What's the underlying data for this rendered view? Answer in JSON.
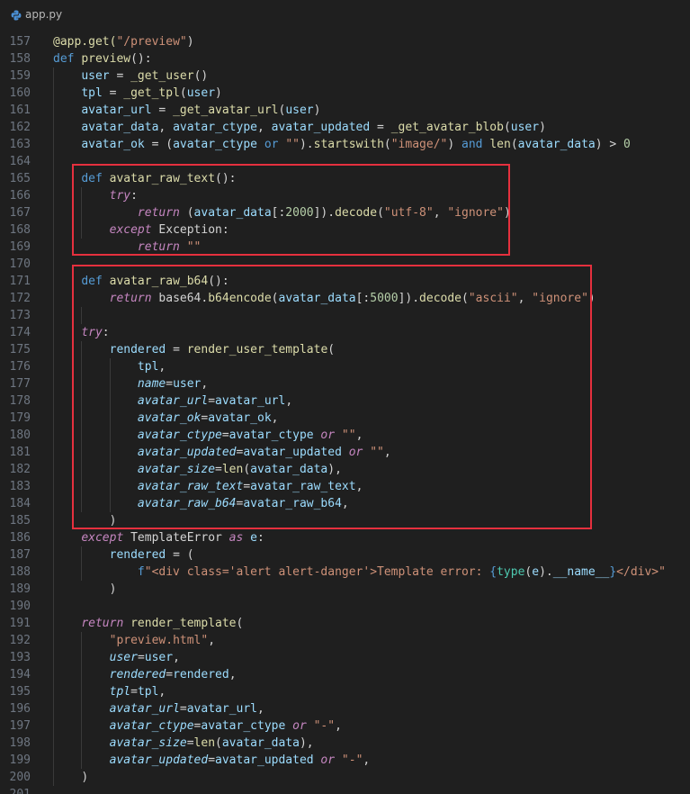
{
  "tab": {
    "filename": "app.py",
    "icon": "python-file-icon"
  },
  "colors": {
    "background": "#1f1f1f",
    "highlight_box": "#e5303e"
  },
  "lines": [
    {
      "n": "157",
      "t": [
        [
          "@app.get(",
          "dec"
        ],
        [
          "\"/preview\"",
          "str"
        ],
        [
          ")",
          "plain"
        ]
      ]
    },
    {
      "n": "158",
      "t": [
        [
          "def ",
          "kw"
        ],
        [
          "preview",
          "fn"
        ],
        [
          "():",
          "plain"
        ]
      ]
    },
    {
      "n": "159",
      "t": [
        [
          "    ",
          "plain"
        ],
        [
          "user",
          "var"
        ],
        [
          " = ",
          "op"
        ],
        [
          "_get_user",
          "fn"
        ],
        [
          "()",
          "plain"
        ]
      ]
    },
    {
      "n": "160",
      "t": [
        [
          "    ",
          "plain"
        ],
        [
          "tpl",
          "var"
        ],
        [
          " = ",
          "op"
        ],
        [
          "_get_tpl",
          "fn"
        ],
        [
          "(",
          "plain"
        ],
        [
          "user",
          "var"
        ],
        [
          ")",
          "plain"
        ]
      ]
    },
    {
      "n": "161",
      "t": [
        [
          "    ",
          "plain"
        ],
        [
          "avatar_url",
          "var"
        ],
        [
          " = ",
          "op"
        ],
        [
          "_get_avatar_url",
          "fn"
        ],
        [
          "(",
          "plain"
        ],
        [
          "user",
          "var"
        ],
        [
          ")",
          "plain"
        ]
      ]
    },
    {
      "n": "162",
      "t": [
        [
          "    ",
          "plain"
        ],
        [
          "avatar_data",
          "var"
        ],
        [
          ", ",
          "plain"
        ],
        [
          "avatar_ctype",
          "var"
        ],
        [
          ", ",
          "plain"
        ],
        [
          "avatar_updated",
          "var"
        ],
        [
          " = ",
          "op"
        ],
        [
          "_get_avatar_blob",
          "fn"
        ],
        [
          "(",
          "plain"
        ],
        [
          "user",
          "var"
        ],
        [
          ")",
          "plain"
        ]
      ]
    },
    {
      "n": "163",
      "t": [
        [
          "    ",
          "plain"
        ],
        [
          "avatar_ok",
          "var"
        ],
        [
          " = (",
          "op"
        ],
        [
          "avatar_ctype",
          "var"
        ],
        [
          " or ",
          "kw"
        ],
        [
          "\"\"",
          "str"
        ],
        [
          ").",
          "plain"
        ],
        [
          "startswith",
          "fn"
        ],
        [
          "(",
          "plain"
        ],
        [
          "\"image/\"",
          "str"
        ],
        [
          ") ",
          "plain"
        ],
        [
          "and ",
          "kw"
        ],
        [
          "len",
          "fn"
        ],
        [
          "(",
          "plain"
        ],
        [
          "avatar_data",
          "var"
        ],
        [
          ") > ",
          "op"
        ],
        [
          "0",
          "num"
        ]
      ]
    },
    {
      "n": "164",
      "t": []
    },
    {
      "n": "165",
      "t": [
        [
          "    ",
          "plain"
        ],
        [
          "def ",
          "kw"
        ],
        [
          "avatar_raw_text",
          "fn"
        ],
        [
          "():",
          "plain"
        ]
      ]
    },
    {
      "n": "166",
      "t": [
        [
          "        ",
          "plain"
        ],
        [
          "try",
          "ctl"
        ],
        [
          ":",
          "plain"
        ]
      ]
    },
    {
      "n": "167",
      "t": [
        [
          "            ",
          "plain"
        ],
        [
          "return ",
          "ctl"
        ],
        [
          "(",
          "plain"
        ],
        [
          "avatar_data",
          "var"
        ],
        [
          "[:",
          "plain"
        ],
        [
          "2000",
          "num"
        ],
        [
          "]).",
          "plain"
        ],
        [
          "decode",
          "fn"
        ],
        [
          "(",
          "plain"
        ],
        [
          "\"utf-8\"",
          "str"
        ],
        [
          ", ",
          "plain"
        ],
        [
          "\"ignore\"",
          "str"
        ],
        [
          ")",
          "plain"
        ]
      ]
    },
    {
      "n": "168",
      "t": [
        [
          "        ",
          "plain"
        ],
        [
          "except ",
          "ctl"
        ],
        [
          "Exception",
          "plain"
        ],
        [
          ":",
          "plain"
        ]
      ]
    },
    {
      "n": "169",
      "t": [
        [
          "            ",
          "plain"
        ],
        [
          "return ",
          "ctl"
        ],
        [
          "\"\"",
          "str"
        ]
      ]
    },
    {
      "n": "170",
      "t": []
    },
    {
      "n": "171",
      "t": [
        [
          "    ",
          "plain"
        ],
        [
          "def ",
          "kw"
        ],
        [
          "avatar_raw_b64",
          "fn"
        ],
        [
          "():",
          "plain"
        ]
      ]
    },
    {
      "n": "172",
      "t": [
        [
          "        ",
          "plain"
        ],
        [
          "return ",
          "ctl"
        ],
        [
          "base64",
          "plain"
        ],
        [
          ".",
          "plain"
        ],
        [
          "b64encode",
          "fn"
        ],
        [
          "(",
          "plain"
        ],
        [
          "avatar_data",
          "var"
        ],
        [
          "[:",
          "plain"
        ],
        [
          "5000",
          "num"
        ],
        [
          "]).",
          "plain"
        ],
        [
          "decode",
          "fn"
        ],
        [
          "(",
          "plain"
        ],
        [
          "\"ascii\"",
          "str"
        ],
        [
          ", ",
          "plain"
        ],
        [
          "\"ignore\"",
          "str"
        ],
        [
          ")",
          "plain"
        ]
      ]
    },
    {
      "n": "173",
      "t": []
    },
    {
      "n": "174",
      "t": [
        [
          "    ",
          "plain"
        ],
        [
          "try",
          "ctl"
        ],
        [
          ":",
          "plain"
        ]
      ]
    },
    {
      "n": "175",
      "t": [
        [
          "        ",
          "plain"
        ],
        [
          "rendered",
          "var"
        ],
        [
          " = ",
          "op"
        ],
        [
          "render_user_template",
          "fn"
        ],
        [
          "(",
          "plain"
        ]
      ]
    },
    {
      "n": "176",
      "t": [
        [
          "            ",
          "plain"
        ],
        [
          "tpl",
          "var"
        ],
        [
          ",",
          "plain"
        ]
      ]
    },
    {
      "n": "177",
      "t": [
        [
          "            ",
          "plain"
        ],
        [
          "name",
          "param"
        ],
        [
          "=",
          "op"
        ],
        [
          "user",
          "var"
        ],
        [
          ",",
          "plain"
        ]
      ]
    },
    {
      "n": "178",
      "t": [
        [
          "            ",
          "plain"
        ],
        [
          "avatar_url",
          "param"
        ],
        [
          "=",
          "op"
        ],
        [
          "avatar_url",
          "var"
        ],
        [
          ",",
          "plain"
        ]
      ]
    },
    {
      "n": "179",
      "t": [
        [
          "            ",
          "plain"
        ],
        [
          "avatar_ok",
          "param"
        ],
        [
          "=",
          "op"
        ],
        [
          "avatar_ok",
          "var"
        ],
        [
          ",",
          "plain"
        ]
      ]
    },
    {
      "n": "180",
      "t": [
        [
          "            ",
          "plain"
        ],
        [
          "avatar_ctype",
          "param"
        ],
        [
          "=",
          "op"
        ],
        [
          "avatar_ctype",
          "var"
        ],
        [
          " or ",
          "ctl"
        ],
        [
          "\"\"",
          "str"
        ],
        [
          ",",
          "plain"
        ]
      ]
    },
    {
      "n": "181",
      "t": [
        [
          "            ",
          "plain"
        ],
        [
          "avatar_updated",
          "param"
        ],
        [
          "=",
          "op"
        ],
        [
          "avatar_updated",
          "var"
        ],
        [
          " or ",
          "ctl"
        ],
        [
          "\"\"",
          "str"
        ],
        [
          ",",
          "plain"
        ]
      ]
    },
    {
      "n": "182",
      "t": [
        [
          "            ",
          "plain"
        ],
        [
          "avatar_size",
          "param"
        ],
        [
          "=",
          "op"
        ],
        [
          "len",
          "fn"
        ],
        [
          "(",
          "plain"
        ],
        [
          "avatar_data",
          "var"
        ],
        [
          "),",
          "plain"
        ]
      ]
    },
    {
      "n": "183",
      "t": [
        [
          "            ",
          "plain"
        ],
        [
          "avatar_raw_text",
          "param"
        ],
        [
          "=",
          "op"
        ],
        [
          "avatar_raw_text",
          "var"
        ],
        [
          ",",
          "plain"
        ]
      ]
    },
    {
      "n": "184",
      "t": [
        [
          "            ",
          "plain"
        ],
        [
          "avatar_raw_b64",
          "param"
        ],
        [
          "=",
          "op"
        ],
        [
          "avatar_raw_b64",
          "var"
        ],
        [
          ",",
          "plain"
        ]
      ]
    },
    {
      "n": "185",
      "t": [
        [
          "        ",
          "plain"
        ],
        [
          ")",
          "plain"
        ]
      ]
    },
    {
      "n": "186",
      "t": [
        [
          "    ",
          "plain"
        ],
        [
          "except ",
          "ctl"
        ],
        [
          "TemplateError",
          "plain"
        ],
        [
          " as ",
          "ctl"
        ],
        [
          "e",
          "var"
        ],
        [
          ":",
          "plain"
        ]
      ]
    },
    {
      "n": "187",
      "t": [
        [
          "        ",
          "plain"
        ],
        [
          "rendered",
          "var"
        ],
        [
          " = (",
          "op"
        ]
      ]
    },
    {
      "n": "188",
      "t": [
        [
          "            ",
          "plain"
        ],
        [
          "f",
          "kw"
        ],
        [
          "\"<div class='alert alert-danger'>Template error: ",
          "str"
        ],
        [
          "{",
          "kw"
        ],
        [
          "type",
          "cls"
        ],
        [
          "(",
          "plain"
        ],
        [
          "e",
          "var"
        ],
        [
          ").",
          "plain"
        ],
        [
          "__name__",
          "var"
        ],
        [
          "}",
          "kw"
        ],
        [
          "</div>\"",
          "str"
        ]
      ]
    },
    {
      "n": "189",
      "t": [
        [
          "        ",
          "plain"
        ],
        [
          ")",
          "plain"
        ]
      ]
    },
    {
      "n": "190",
      "t": []
    },
    {
      "n": "191",
      "t": [
        [
          "    ",
          "plain"
        ],
        [
          "return ",
          "ctl"
        ],
        [
          "render_template",
          "fn"
        ],
        [
          "(",
          "plain"
        ]
      ]
    },
    {
      "n": "192",
      "t": [
        [
          "        ",
          "plain"
        ],
        [
          "\"preview.html\"",
          "str"
        ],
        [
          ",",
          "plain"
        ]
      ]
    },
    {
      "n": "193",
      "t": [
        [
          "        ",
          "plain"
        ],
        [
          "user",
          "param"
        ],
        [
          "=",
          "op"
        ],
        [
          "user",
          "var"
        ],
        [
          ",",
          "plain"
        ]
      ]
    },
    {
      "n": "194",
      "t": [
        [
          "        ",
          "plain"
        ],
        [
          "rendered",
          "param"
        ],
        [
          "=",
          "op"
        ],
        [
          "rendered",
          "var"
        ],
        [
          ",",
          "plain"
        ]
      ]
    },
    {
      "n": "195",
      "t": [
        [
          "        ",
          "plain"
        ],
        [
          "tpl",
          "param"
        ],
        [
          "=",
          "op"
        ],
        [
          "tpl",
          "var"
        ],
        [
          ",",
          "plain"
        ]
      ]
    },
    {
      "n": "196",
      "t": [
        [
          "        ",
          "plain"
        ],
        [
          "avatar_url",
          "param"
        ],
        [
          "=",
          "op"
        ],
        [
          "avatar_url",
          "var"
        ],
        [
          ",",
          "plain"
        ]
      ]
    },
    {
      "n": "197",
      "t": [
        [
          "        ",
          "plain"
        ],
        [
          "avatar_ctype",
          "param"
        ],
        [
          "=",
          "op"
        ],
        [
          "avatar_ctype",
          "var"
        ],
        [
          " or ",
          "ctl"
        ],
        [
          "\"-\"",
          "str"
        ],
        [
          ",",
          "plain"
        ]
      ]
    },
    {
      "n": "198",
      "t": [
        [
          "        ",
          "plain"
        ],
        [
          "avatar_size",
          "param"
        ],
        [
          "=",
          "op"
        ],
        [
          "len",
          "fn"
        ],
        [
          "(",
          "plain"
        ],
        [
          "avatar_data",
          "var"
        ],
        [
          "),",
          "plain"
        ]
      ]
    },
    {
      "n": "199",
      "t": [
        [
          "        ",
          "plain"
        ],
        [
          "avatar_updated",
          "param"
        ],
        [
          "=",
          "op"
        ],
        [
          "avatar_updated",
          "var"
        ],
        [
          " or ",
          "ctl"
        ],
        [
          "\"-\"",
          "str"
        ],
        [
          ",",
          "plain"
        ]
      ]
    },
    {
      "n": "200",
      "t": [
        [
          "    ",
          "plain"
        ],
        [
          ")",
          "plain"
        ]
      ]
    },
    {
      "n": "201",
      "t": []
    }
  ]
}
